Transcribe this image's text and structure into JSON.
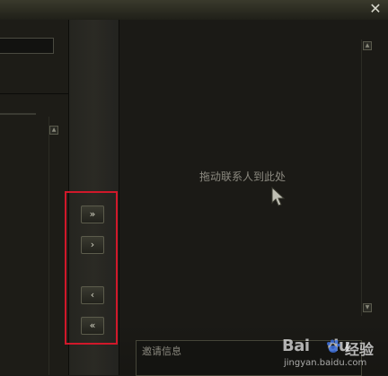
{
  "window": {
    "close_glyph": "✕"
  },
  "transfer_buttons": [
    {
      "label": "»",
      "icon": "double-chevron-right-icon"
    },
    {
      "label": "›",
      "icon": "chevron-right-icon"
    },
    {
      "label": "‹",
      "icon": "chevron-left-icon"
    },
    {
      "label": "«",
      "icon": "double-chevron-left-icon"
    }
  ],
  "drop_area": {
    "placeholder": "拖动联系人到此处"
  },
  "invite": {
    "label": "邀请信息"
  },
  "watermark": {
    "logo": "Bai",
    "logo_suffix": "du",
    "text": "经验",
    "url": "jingyan.baidu.com"
  },
  "scroll": {
    "up_glyph": "▲",
    "down_glyph": "▼"
  },
  "colors": {
    "highlight": "#d0182a",
    "background": "#1c1b17"
  }
}
